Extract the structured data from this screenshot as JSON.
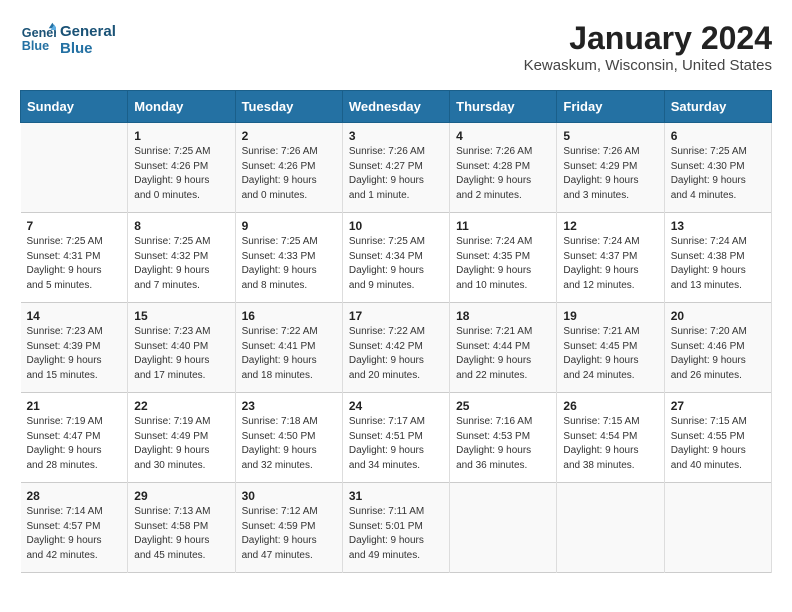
{
  "logo": {
    "line1": "General",
    "line2": "Blue"
  },
  "title": "January 2024",
  "subtitle": "Kewaskum, Wisconsin, United States",
  "days_of_week": [
    "Sunday",
    "Monday",
    "Tuesday",
    "Wednesday",
    "Thursday",
    "Friday",
    "Saturday"
  ],
  "weeks": [
    [
      {
        "day": "",
        "info": ""
      },
      {
        "day": "1",
        "info": "Sunrise: 7:25 AM\nSunset: 4:26 PM\nDaylight: 9 hours\nand 0 minutes."
      },
      {
        "day": "2",
        "info": "Sunrise: 7:26 AM\nSunset: 4:26 PM\nDaylight: 9 hours\nand 0 minutes."
      },
      {
        "day": "3",
        "info": "Sunrise: 7:26 AM\nSunset: 4:27 PM\nDaylight: 9 hours\nand 1 minute."
      },
      {
        "day": "4",
        "info": "Sunrise: 7:26 AM\nSunset: 4:28 PM\nDaylight: 9 hours\nand 2 minutes."
      },
      {
        "day": "5",
        "info": "Sunrise: 7:26 AM\nSunset: 4:29 PM\nDaylight: 9 hours\nand 3 minutes."
      },
      {
        "day": "6",
        "info": "Sunrise: 7:25 AM\nSunset: 4:30 PM\nDaylight: 9 hours\nand 4 minutes."
      }
    ],
    [
      {
        "day": "7",
        "info": "Sunrise: 7:25 AM\nSunset: 4:31 PM\nDaylight: 9 hours\nand 5 minutes."
      },
      {
        "day": "8",
        "info": "Sunrise: 7:25 AM\nSunset: 4:32 PM\nDaylight: 9 hours\nand 7 minutes."
      },
      {
        "day": "9",
        "info": "Sunrise: 7:25 AM\nSunset: 4:33 PM\nDaylight: 9 hours\nand 8 minutes."
      },
      {
        "day": "10",
        "info": "Sunrise: 7:25 AM\nSunset: 4:34 PM\nDaylight: 9 hours\nand 9 minutes."
      },
      {
        "day": "11",
        "info": "Sunrise: 7:24 AM\nSunset: 4:35 PM\nDaylight: 9 hours\nand 10 minutes."
      },
      {
        "day": "12",
        "info": "Sunrise: 7:24 AM\nSunset: 4:37 PM\nDaylight: 9 hours\nand 12 minutes."
      },
      {
        "day": "13",
        "info": "Sunrise: 7:24 AM\nSunset: 4:38 PM\nDaylight: 9 hours\nand 13 minutes."
      }
    ],
    [
      {
        "day": "14",
        "info": "Sunrise: 7:23 AM\nSunset: 4:39 PM\nDaylight: 9 hours\nand 15 minutes."
      },
      {
        "day": "15",
        "info": "Sunrise: 7:23 AM\nSunset: 4:40 PM\nDaylight: 9 hours\nand 17 minutes."
      },
      {
        "day": "16",
        "info": "Sunrise: 7:22 AM\nSunset: 4:41 PM\nDaylight: 9 hours\nand 18 minutes."
      },
      {
        "day": "17",
        "info": "Sunrise: 7:22 AM\nSunset: 4:42 PM\nDaylight: 9 hours\nand 20 minutes."
      },
      {
        "day": "18",
        "info": "Sunrise: 7:21 AM\nSunset: 4:44 PM\nDaylight: 9 hours\nand 22 minutes."
      },
      {
        "day": "19",
        "info": "Sunrise: 7:21 AM\nSunset: 4:45 PM\nDaylight: 9 hours\nand 24 minutes."
      },
      {
        "day": "20",
        "info": "Sunrise: 7:20 AM\nSunset: 4:46 PM\nDaylight: 9 hours\nand 26 minutes."
      }
    ],
    [
      {
        "day": "21",
        "info": "Sunrise: 7:19 AM\nSunset: 4:47 PM\nDaylight: 9 hours\nand 28 minutes."
      },
      {
        "day": "22",
        "info": "Sunrise: 7:19 AM\nSunset: 4:49 PM\nDaylight: 9 hours\nand 30 minutes."
      },
      {
        "day": "23",
        "info": "Sunrise: 7:18 AM\nSunset: 4:50 PM\nDaylight: 9 hours\nand 32 minutes."
      },
      {
        "day": "24",
        "info": "Sunrise: 7:17 AM\nSunset: 4:51 PM\nDaylight: 9 hours\nand 34 minutes."
      },
      {
        "day": "25",
        "info": "Sunrise: 7:16 AM\nSunset: 4:53 PM\nDaylight: 9 hours\nand 36 minutes."
      },
      {
        "day": "26",
        "info": "Sunrise: 7:15 AM\nSunset: 4:54 PM\nDaylight: 9 hours\nand 38 minutes."
      },
      {
        "day": "27",
        "info": "Sunrise: 7:15 AM\nSunset: 4:55 PM\nDaylight: 9 hours\nand 40 minutes."
      }
    ],
    [
      {
        "day": "28",
        "info": "Sunrise: 7:14 AM\nSunset: 4:57 PM\nDaylight: 9 hours\nand 42 minutes."
      },
      {
        "day": "29",
        "info": "Sunrise: 7:13 AM\nSunset: 4:58 PM\nDaylight: 9 hours\nand 45 minutes."
      },
      {
        "day": "30",
        "info": "Sunrise: 7:12 AM\nSunset: 4:59 PM\nDaylight: 9 hours\nand 47 minutes."
      },
      {
        "day": "31",
        "info": "Sunrise: 7:11 AM\nSunset: 5:01 PM\nDaylight: 9 hours\nand 49 minutes."
      },
      {
        "day": "",
        "info": ""
      },
      {
        "day": "",
        "info": ""
      },
      {
        "day": "",
        "info": ""
      }
    ]
  ]
}
